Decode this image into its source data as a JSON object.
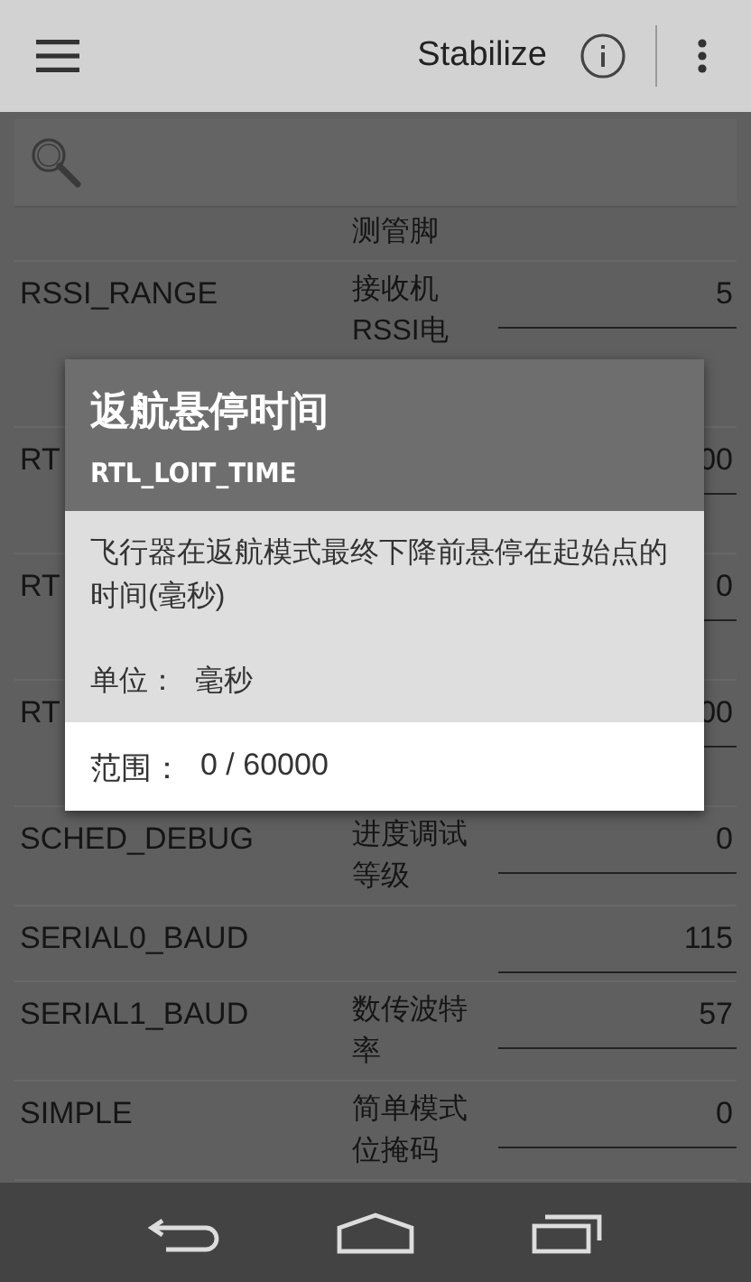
{
  "app_bar": {
    "title": "Stabilize"
  },
  "params": [
    {
      "kind": "partial",
      "description": "测管脚"
    },
    {
      "kind": "clipped",
      "name": "RSSI_RANGE",
      "description": "接收机RSSI电",
      "value": "5"
    },
    {
      "kind": "covered",
      "name": "RT",
      "value": "00"
    },
    {
      "kind": "covered",
      "name": "RT",
      "value": "0"
    },
    {
      "kind": "covered",
      "name": "RT",
      "value": "00"
    },
    {
      "kind": "full",
      "name": "SCHED_DEBUG",
      "description": "进度调试等级",
      "value": "0"
    },
    {
      "kind": "full",
      "name": "SERIAL0_BAUD",
      "value": "115"
    },
    {
      "kind": "full",
      "name": "SERIAL1_BAUD",
      "description": "数传波特率",
      "value": "57"
    },
    {
      "kind": "full",
      "name": "SIMPLE",
      "description": "简单模式位掩码",
      "value": "0"
    }
  ],
  "dialog": {
    "title": "返航悬停时间",
    "subtitle": "RTL_LOIT_TIME",
    "description": "飞行器在返航模式最终下降前悬停在起始点的时间(毫秒)",
    "unit_label": "单位：",
    "unit": "毫秒",
    "range_label": "范围：",
    "range": "0 / 60000"
  }
}
